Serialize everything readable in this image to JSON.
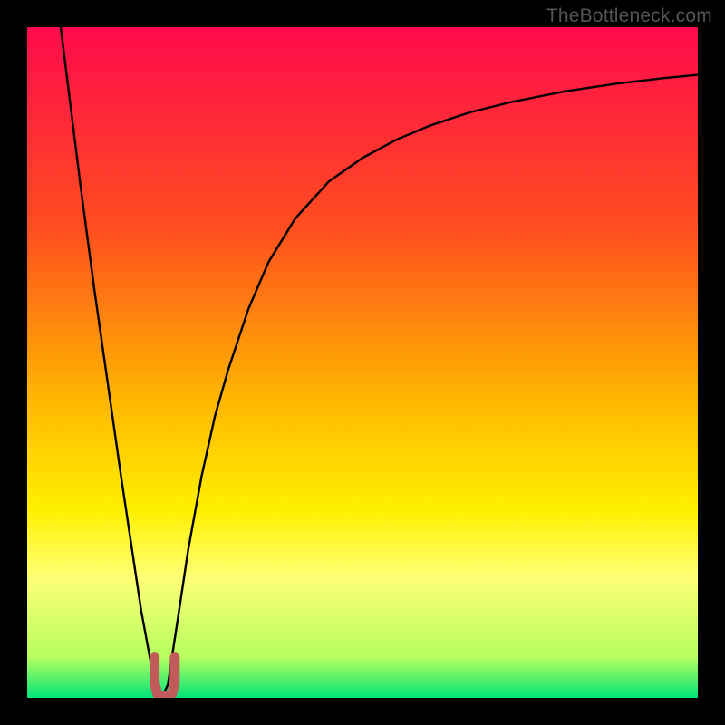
{
  "watermark": "TheBottleneck.com",
  "chart_data": {
    "type": "line",
    "title": "",
    "xlabel": "",
    "ylabel": "",
    "xlim": [
      0,
      100
    ],
    "ylim": [
      0,
      100
    ],
    "gradient_stops": [
      {
        "offset": 0.0,
        "color": "#ff0a4c"
      },
      {
        "offset": 0.3,
        "color": "#ff4e1f"
      },
      {
        "offset": 0.55,
        "color": "#ffb400"
      },
      {
        "offset": 0.72,
        "color": "#fff000"
      },
      {
        "offset": 0.82,
        "color": "#ffff74"
      },
      {
        "offset": 0.94,
        "color": "#b6ff60"
      },
      {
        "offset": 1.0,
        "color": "#00e478"
      }
    ],
    "series": [
      {
        "name": "curve",
        "stroke": "#000000",
        "stroke_width": 2.4,
        "x": [
          5.0,
          6.5,
          8.0,
          10.0,
          12.0,
          14.0,
          15.5,
          17.0,
          18.3,
          19.2,
          19.8,
          20.3,
          21.0,
          21.5,
          22.5,
          24.0,
          26.0,
          28.0,
          30.0,
          33.0,
          36.0,
          40.0,
          45.0,
          50.0,
          55.0,
          60.0,
          66.0,
          72.0,
          80.0,
          88.0,
          95.0,
          100.0
        ],
        "y": [
          100.0,
          88.0,
          76.0,
          61.0,
          47.0,
          33.0,
          23.0,
          13.0,
          6.0,
          2.0,
          0.5,
          0.5,
          2.0,
          5.5,
          12.0,
          22.0,
          33.0,
          42.0,
          49.0,
          58.0,
          65.0,
          71.5,
          77.0,
          80.5,
          83.2,
          85.3,
          87.3,
          88.8,
          90.4,
          91.6,
          92.4,
          92.9
        ]
      }
    ],
    "marker": {
      "name": "valley-marker",
      "stroke": "#c15a5a",
      "stroke_width": 11,
      "x": [
        19.0,
        19.0,
        19.4,
        20.4,
        21.6,
        22.0,
        22.0
      ],
      "y": [
        6.0,
        2.2,
        0.6,
        0.1,
        0.6,
        2.2,
        6.0
      ]
    }
  }
}
